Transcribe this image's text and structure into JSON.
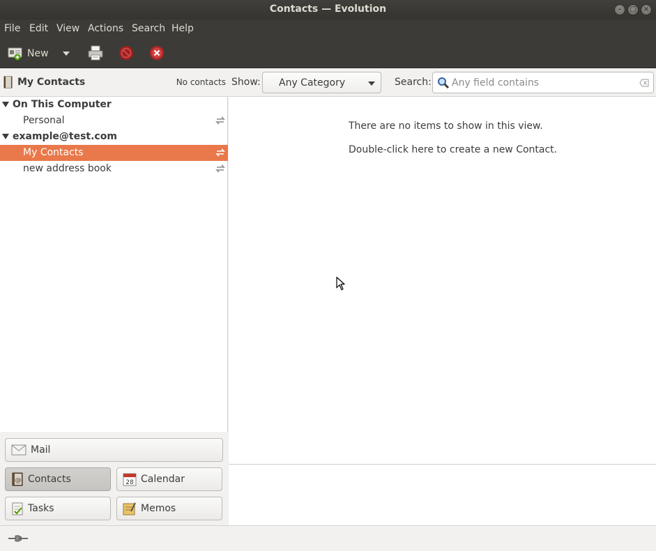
{
  "window": {
    "title": "Contacts — Evolution"
  },
  "menubar": {
    "items": [
      "File",
      "Edit",
      "View",
      "Actions",
      "Search",
      "Help"
    ]
  },
  "toolbar": {
    "new_label": "New"
  },
  "sidebar": {
    "header_title": "My Contacts",
    "header_count": "No contacts",
    "groups": [
      {
        "label": "On This Computer",
        "items": [
          {
            "label": "Personal"
          }
        ]
      },
      {
        "label": "example@test.com",
        "items": [
          {
            "label": "My Contacts",
            "selected": true
          },
          {
            "label": "new address book"
          }
        ]
      }
    ],
    "nav": {
      "mail": "Mail",
      "contacts": "Contacts",
      "calendar": "Calendar",
      "calendar_day": "28",
      "tasks": "Tasks",
      "memos": "Memos"
    }
  },
  "filter": {
    "show_label": "Show:",
    "category_value": "Any Category",
    "search_label": "Search:",
    "search_placeholder": "Any field contains"
  },
  "content": {
    "empty_line1": "There are no items to show in this view.",
    "empty_line2": "Double-click here to create a new Contact."
  },
  "colors": {
    "accent": "#e9784a",
    "chrome": "#3c3b37"
  }
}
